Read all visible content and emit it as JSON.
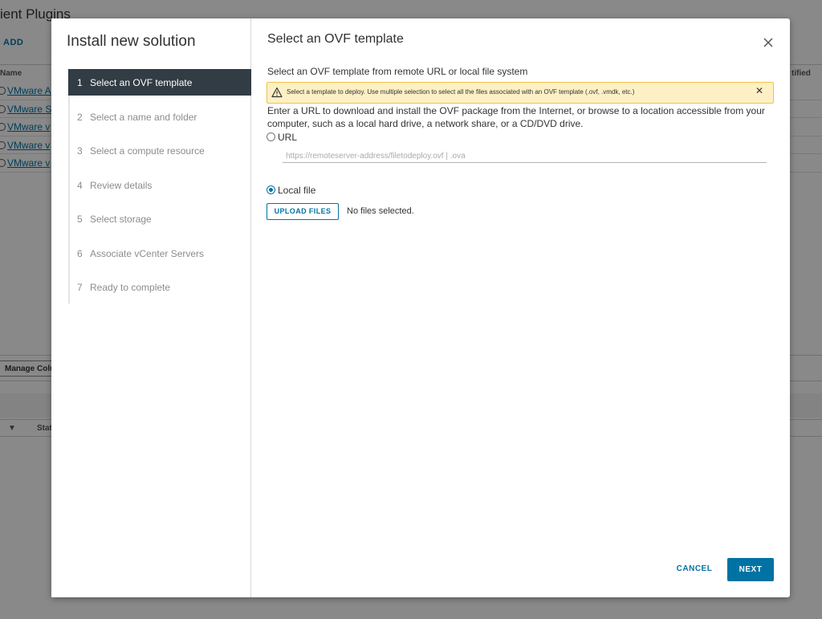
{
  "background": {
    "title": "ient Plugins",
    "add_label": "ADD",
    "col_name": "Name",
    "col_certified": "tified",
    "rows": [
      "VMware A",
      "VMware S",
      "VMware v",
      "VMware v",
      "VMware v"
    ],
    "manage_columns": "Manage Colu",
    "lower_col_status": "Stat"
  },
  "wizard": {
    "title": "Install new solution",
    "steps": [
      {
        "num": "1",
        "label": "Select an OVF template"
      },
      {
        "num": "2",
        "label": "Select a name and folder"
      },
      {
        "num": "3",
        "label": "Select a compute resource"
      },
      {
        "num": "4",
        "label": "Review details"
      },
      {
        "num": "5",
        "label": "Select storage"
      },
      {
        "num": "6",
        "label": "Associate vCenter Servers"
      },
      {
        "num": "7",
        "label": "Ready to complete"
      }
    ],
    "active_step": 1
  },
  "content": {
    "title": "Select an OVF template",
    "subtitle": "Select an OVF template from remote URL or local file system",
    "alert_text": "Select a template to deploy. Use multiple selection to select all the files associated with an OVF template (.ovf, .vmdk, etc.)",
    "description": "Enter a URL to download and install the OVF package from the Internet, or browse to a location accessible from your computer, such as a local hard drive, a network share, or a CD/DVD drive.",
    "url_label": "URL",
    "url_placeholder": "https://remoteserver-address/filetodeploy.ovf | .ova",
    "local_file_label": "Local file",
    "selected_option": "Local file",
    "upload_label": "UPLOAD FILES",
    "no_files_text": "No files selected."
  },
  "footer": {
    "cancel_label": "CANCEL",
    "next_label": "NEXT"
  },
  "colors": {
    "accent": "#0072a3",
    "active_step_bg": "#313c45",
    "alert_bg": "#fdf0c5",
    "alert_border": "#f0c14b"
  }
}
